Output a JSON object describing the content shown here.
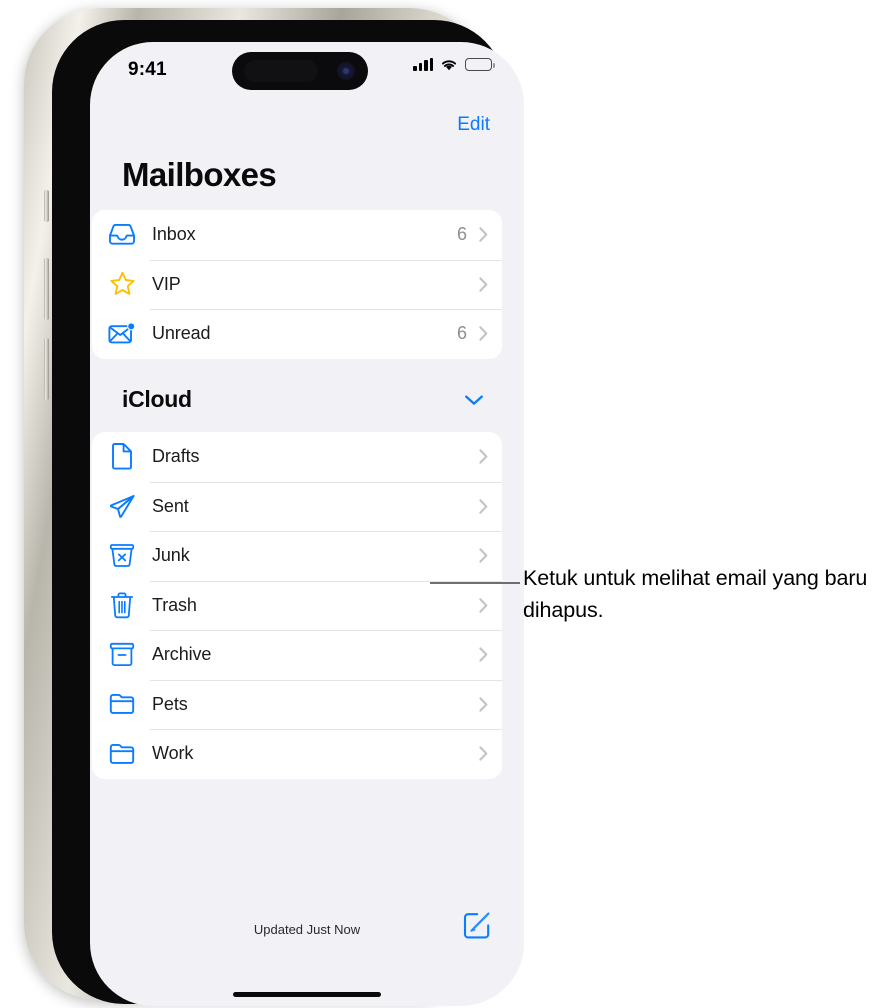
{
  "status_bar": {
    "time": "9:41",
    "cellular_icon": "cellular-signal-icon",
    "wifi_icon": "wifi-icon",
    "battery_icon": "battery-full-icon"
  },
  "nav": {
    "edit_label": "Edit",
    "title": "Mailboxes"
  },
  "primary_mailboxes": [
    {
      "label": "Inbox",
      "count": "6",
      "icon": "inbox-tray-icon"
    },
    {
      "label": "VIP",
      "count": "",
      "icon": "star-icon"
    },
    {
      "label": "Unread",
      "count": "6",
      "icon": "envelope-badge-icon"
    }
  ],
  "icloud_section": {
    "title": "iCloud",
    "collapse_icon": "chevron-down-icon",
    "items": [
      {
        "label": "Drafts",
        "icon": "document-icon"
      },
      {
        "label": "Sent",
        "icon": "paper-plane-icon"
      },
      {
        "label": "Junk",
        "icon": "junk-bin-icon"
      },
      {
        "label": "Trash",
        "icon": "trash-icon"
      },
      {
        "label": "Archive",
        "icon": "archive-box-icon"
      },
      {
        "label": "Pets",
        "icon": "folder-icon"
      },
      {
        "label": "Work",
        "icon": "folder-icon"
      }
    ]
  },
  "bottom_bar": {
    "status_text": "Updated Just Now",
    "compose_icon": "compose-icon"
  },
  "callout": {
    "text": "Ketuk untuk melihat email yang baru dihapus.",
    "target": "trash-row-chevron"
  },
  "colors": {
    "accent_blue": "#0a7cff",
    "star_yellow": "#ffbf00",
    "screen_bg": "#f2f1f6",
    "card_bg": "#ffffff",
    "chevron_gray": "#c4c4c6"
  }
}
